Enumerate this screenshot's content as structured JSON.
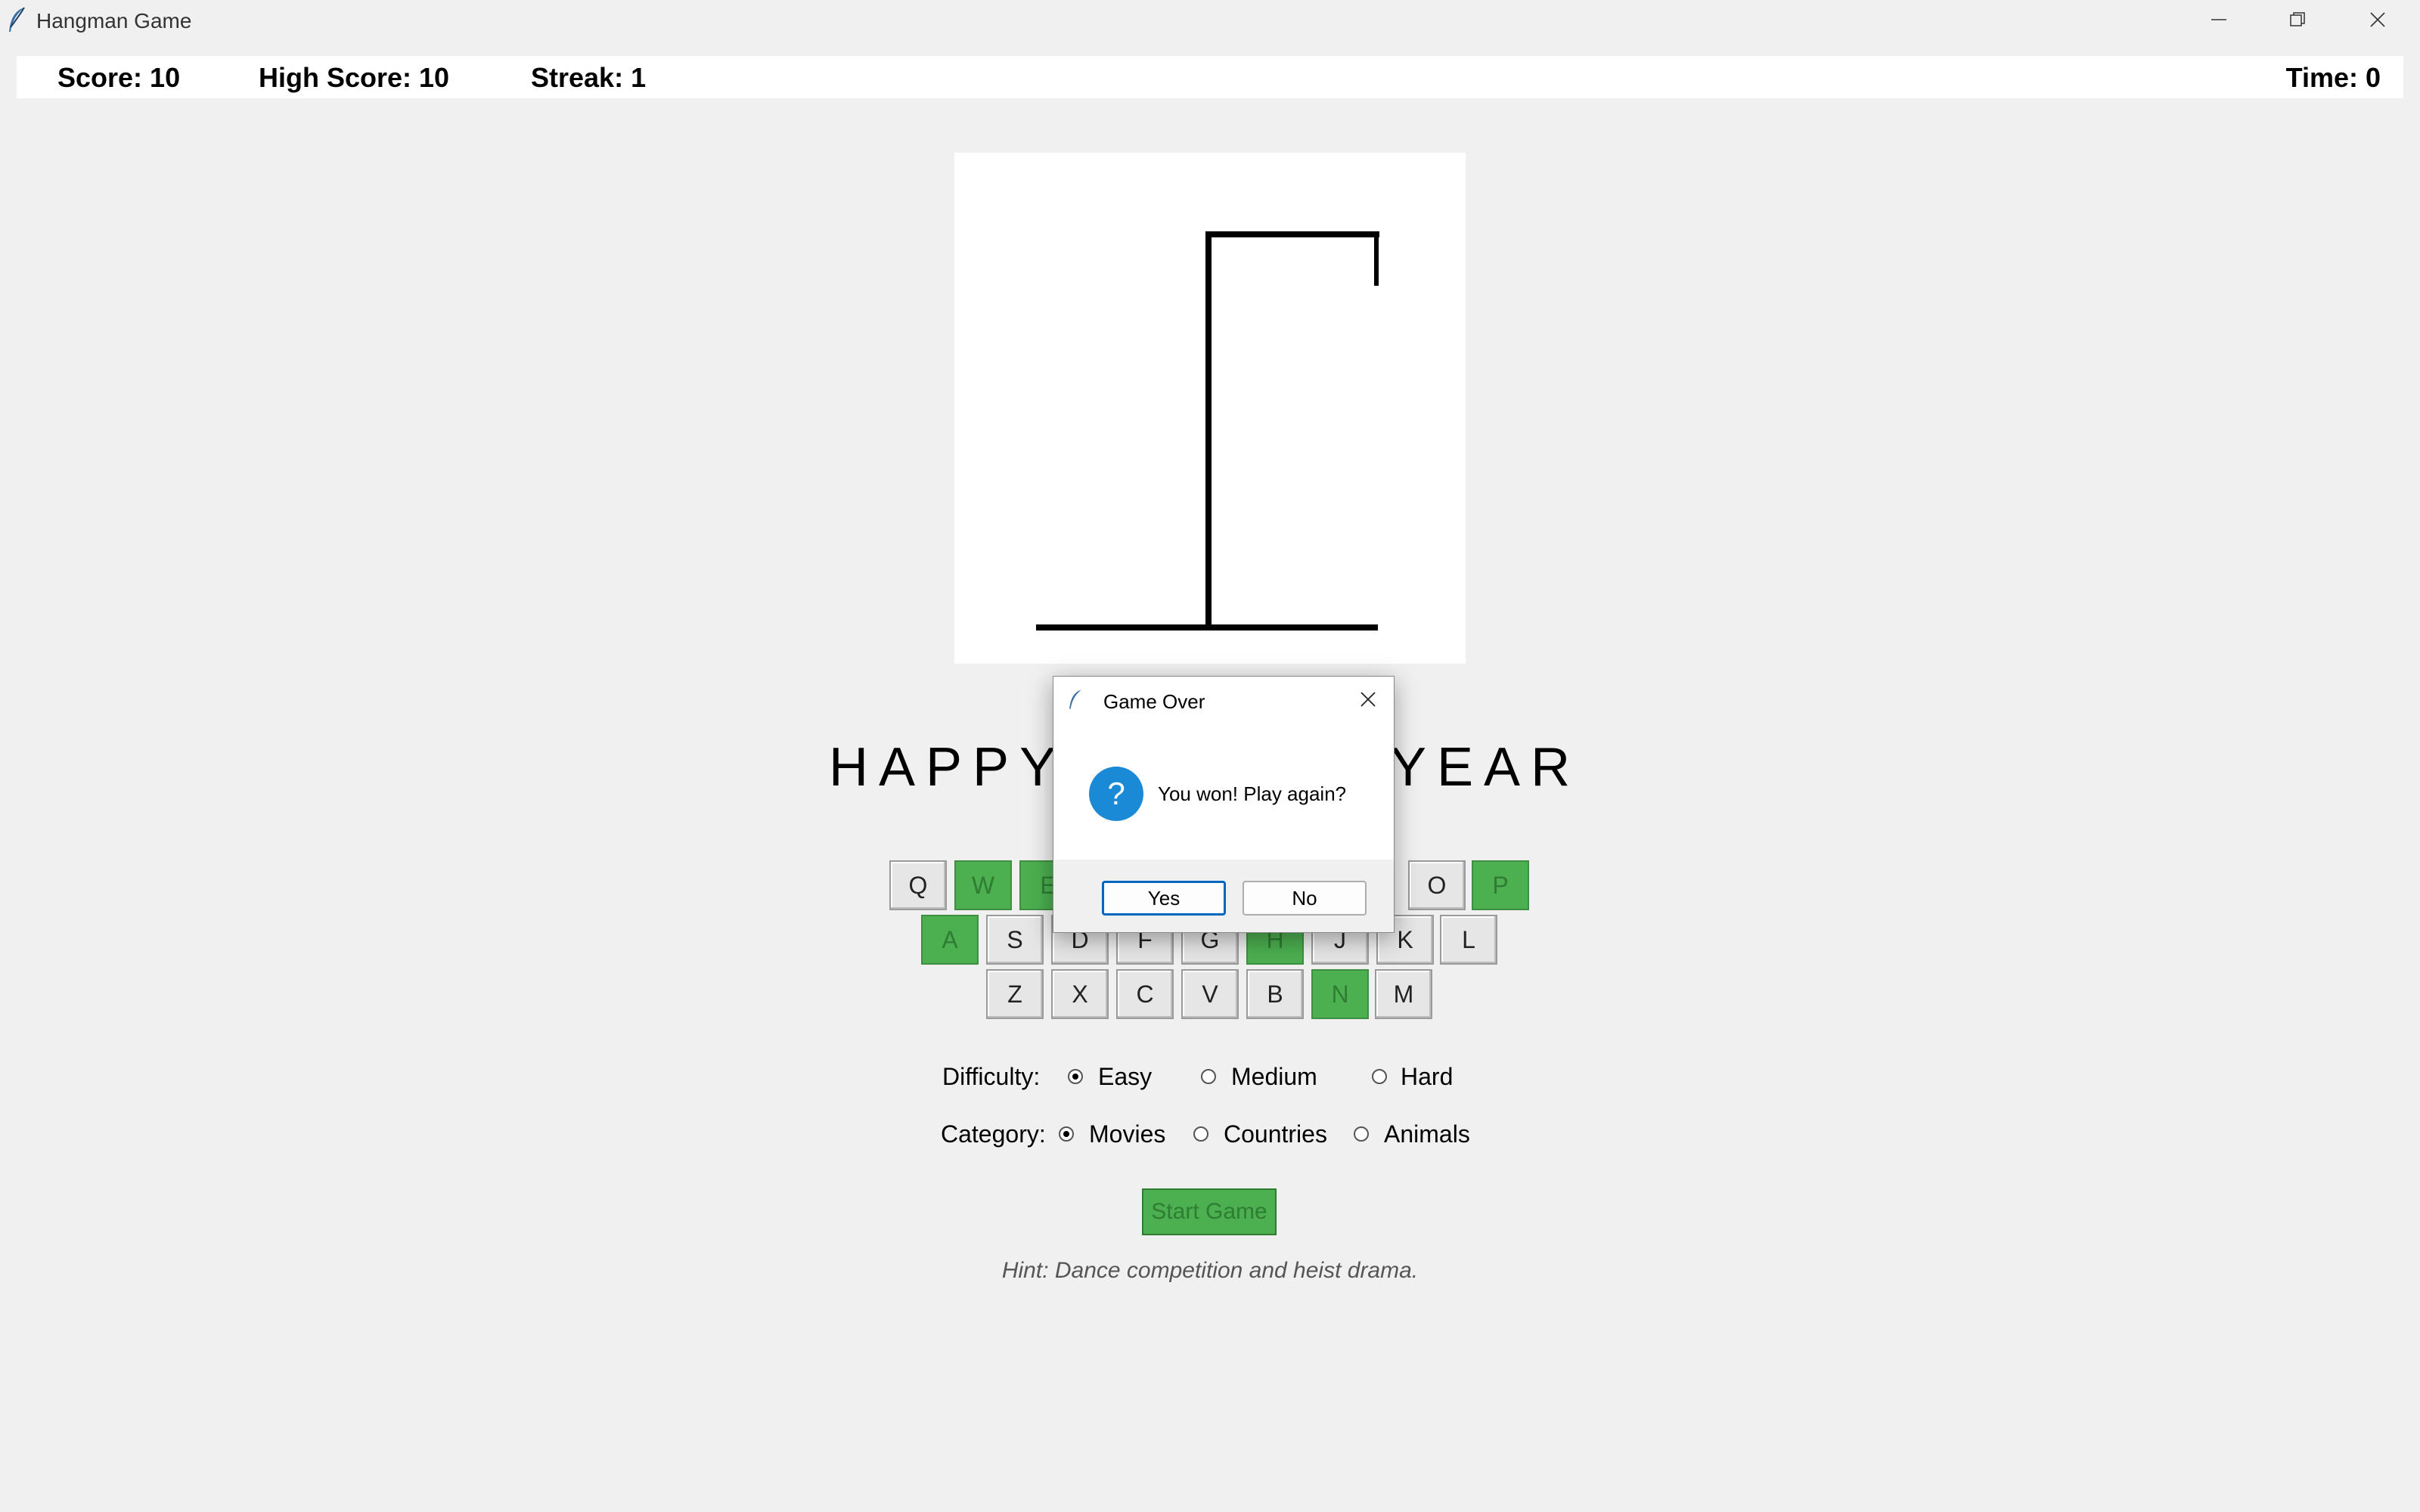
{
  "window": {
    "title": "Hangman Game"
  },
  "stats": {
    "score": "Score: 10",
    "high_score": "High Score: 10",
    "streak": "Streak: 1",
    "time": "Time: 0"
  },
  "word": {
    "left_visible": "HAPPY",
    "right_visible": "YEAR"
  },
  "keyboard": {
    "row1": [
      {
        "letter": "Q",
        "used": false
      },
      {
        "letter": "W",
        "used": true
      },
      {
        "letter": "E",
        "used": true
      },
      {
        "letter": "O",
        "used": false
      },
      {
        "letter": "P",
        "used": true
      }
    ],
    "row2": [
      {
        "letter": "A",
        "used": true
      },
      {
        "letter": "S",
        "used": false
      },
      {
        "letter": "D",
        "used": false
      },
      {
        "letter": "F",
        "used": false
      },
      {
        "letter": "G",
        "used": false
      },
      {
        "letter": "H",
        "used": true
      },
      {
        "letter": "J",
        "used": false
      },
      {
        "letter": "K",
        "used": false
      },
      {
        "letter": "L",
        "used": false
      }
    ],
    "row3": [
      {
        "letter": "Z",
        "used": false
      },
      {
        "letter": "X",
        "used": false
      },
      {
        "letter": "C",
        "used": false
      },
      {
        "letter": "V",
        "used": false
      },
      {
        "letter": "B",
        "used": false
      },
      {
        "letter": "N",
        "used": true
      },
      {
        "letter": "M",
        "used": false
      }
    ]
  },
  "difficulty": {
    "label": "Difficulty:",
    "options": [
      "Easy",
      "Medium",
      "Hard"
    ],
    "selected": "Easy"
  },
  "category": {
    "label": "Category:",
    "options": [
      "Movies",
      "Countries",
      "Animals"
    ],
    "selected": "Movies"
  },
  "start_button": "Start Game",
  "hint": "Hint: Dance competition and heist drama.",
  "dialog": {
    "title": "Game Over",
    "message": "You won! Play again?",
    "yes": "Yes",
    "no": "No"
  },
  "colors": {
    "used_key": "#4caf50",
    "accent": "#0067c0"
  }
}
